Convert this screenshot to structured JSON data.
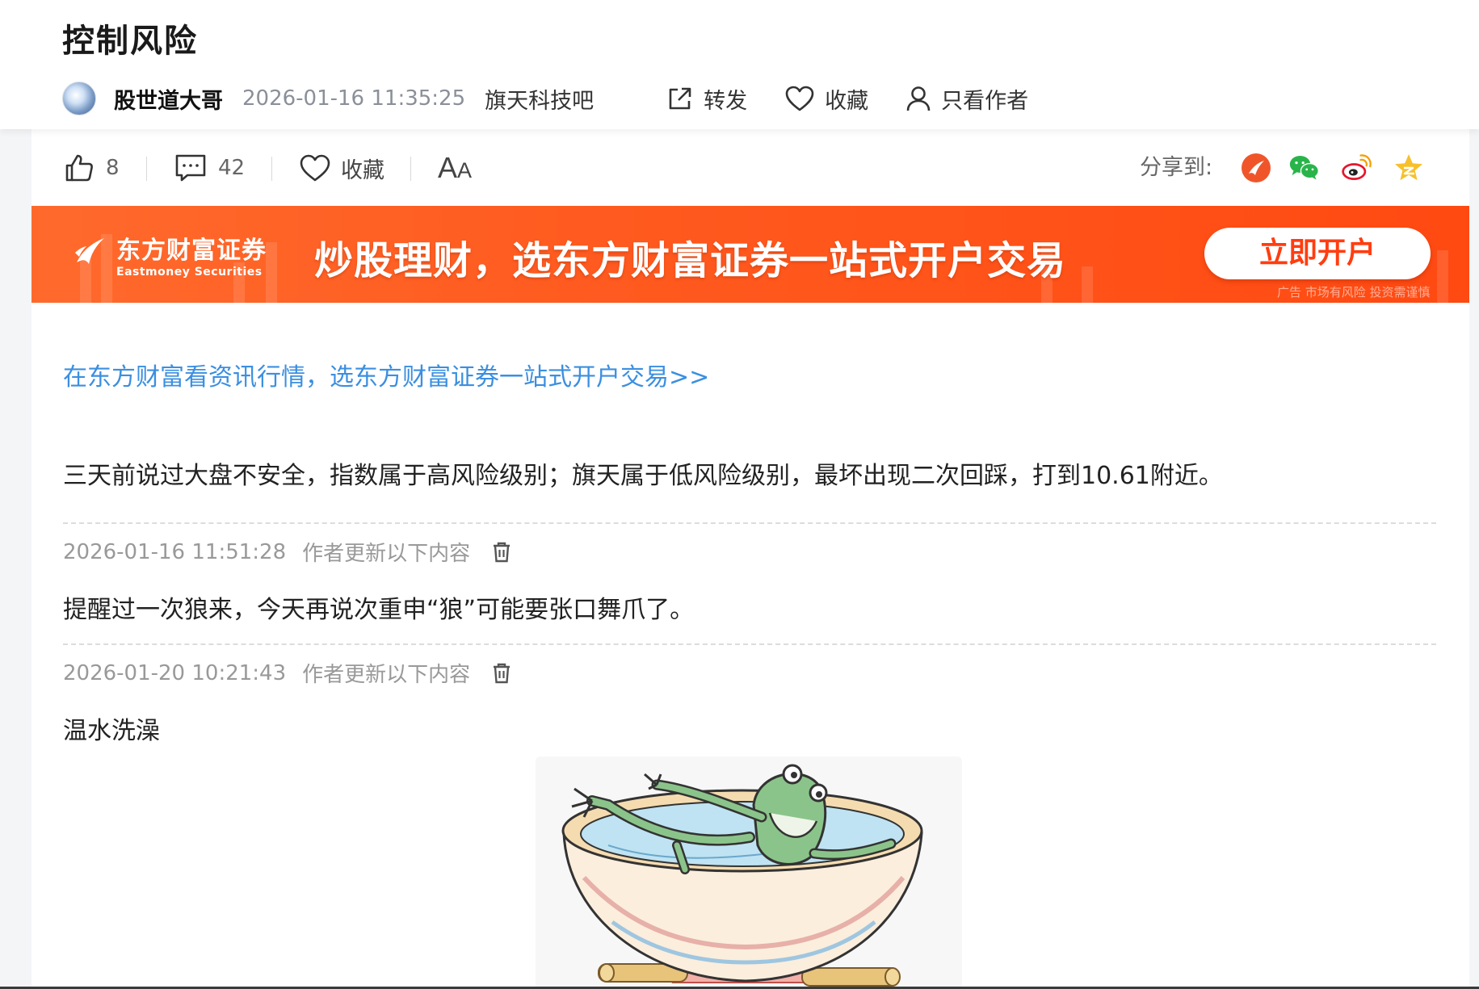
{
  "header": {
    "title": "控制风险",
    "author": "股世道大哥",
    "time": "2026-01-16 11:35:25",
    "bar": "旗天科技吧",
    "actions": {
      "forward": "转发",
      "favorite": "收藏",
      "author_only": "只看作者"
    }
  },
  "toolbar": {
    "likes": "8",
    "comments": "42",
    "favorite": "收藏",
    "font_big": "A",
    "font_small": "A",
    "share_label": "分享到:",
    "share_icons": [
      "eastmoney-icon",
      "wechat-icon",
      "weibo-icon",
      "qzone-icon"
    ]
  },
  "banner": {
    "brand": "东方财富证券",
    "brand_en": "Eastmoney Securities",
    "slogan": "炒股理财，选东方财富证券一站式开户交易",
    "button": "立即开户",
    "disclaimer": "广告 市场有风险 投资需谨慎"
  },
  "content": {
    "promo_link": "在东方财富看资讯行情，选东方财富证券一站式开户交易>>",
    "paragraph1": "三天前说过大盘不安全，指数属于高风险级别；旗天属于低风险级别，最坏出现二次回踩，打到10.61附近。",
    "updates": [
      {
        "time": "2026-01-16 11:51:28",
        "label": "作者更新以下内容",
        "text": "提醒过一次狼来，今天再说次重申“狼”可能要张口舞爪了。"
      },
      {
        "time": "2026-01-20 10:21:43",
        "label": "作者更新以下内容",
        "text": "温水洗澡"
      }
    ]
  },
  "colors": {
    "link": "#3b8fe0",
    "banner": "#ff5a1f",
    "share_eastmoney": "#f0552a",
    "share_wechat": "#29b44a",
    "share_weibo": "#e6162d",
    "share_qzone": "#f7c02b"
  }
}
